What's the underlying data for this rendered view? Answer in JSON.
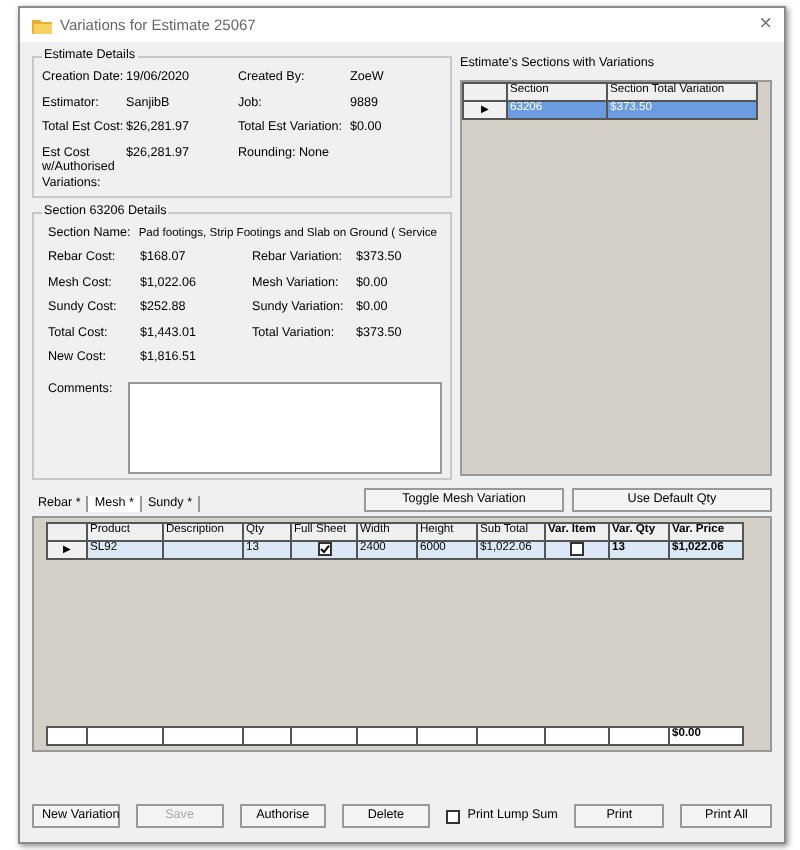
{
  "window": {
    "title": "Variations for Estimate 25067",
    "close": "×"
  },
  "estimate_details": {
    "title": "Estimate Details",
    "rows": [
      {
        "cells": [
          {
            "label": "Creation Date:",
            "value": "19/06/2020"
          },
          {
            "label": "Created By:",
            "value": "ZoeW"
          }
        ]
      },
      {
        "cells": [
          {
            "label": "Estimator:",
            "value": "SanjibB"
          },
          {
            "label": "Job:",
            "value": "9889"
          }
        ]
      },
      {
        "cells": [
          {
            "label": "Total Est Cost:",
            "value": "$26,281.97"
          },
          {
            "label": "Total Est Variation:",
            "value": "$0.00"
          }
        ]
      },
      {
        "cells": [
          {
            "label": "Est Cost w/Authorised Variations:",
            "value": "$26,281.97"
          },
          {
            "label": "Rounding: None"
          }
        ]
      }
    ]
  },
  "section_details": {
    "title": "Section 63206 Details",
    "name_label": "Section Name:",
    "name_value": "Pad footings, Strip Footings and Slab on Ground ( Service",
    "rows": [
      {
        "cells": [
          {
            "label": "Rebar Cost:",
            "value": "$168.07"
          },
          {
            "label": "Rebar Variation:",
            "value": "$373.50"
          }
        ]
      },
      {
        "cells": [
          {
            "label": "Mesh Cost:",
            "value": "$1,022.06"
          },
          {
            "label": "Mesh Variation:",
            "value": "$0.00"
          }
        ]
      },
      {
        "cells": [
          {
            "label": "Sundy Cost:",
            "value": "$252.88"
          },
          {
            "label": "Sundy Variation:",
            "value": "$0.00"
          }
        ]
      },
      {
        "cells": [
          {
            "label": "Total Cost:",
            "value": "$1,443.01"
          },
          {
            "label": "Total Variation:",
            "value": "$373.50"
          }
        ]
      },
      {
        "cells": [
          {
            "label": "New Cost:",
            "value": "$1,816.51"
          }
        ]
      }
    ],
    "comments_label": "Comments:"
  },
  "sections_grid": {
    "title": "Estimate's Sections with Variations",
    "columns": [
      "Section",
      "Section Total Variation"
    ],
    "rows": [
      {
        "marker": "▶",
        "cells": [
          "63206",
          "$373.50"
        ],
        "selected": true
      }
    ]
  },
  "tabs": [
    {
      "label": "Rebar *",
      "selected": false
    },
    {
      "label": "Mesh *",
      "selected": true
    },
    {
      "label": "Sundy *",
      "selected": false
    }
  ],
  "toolbar_buttons": [
    "Toggle Mesh Variation",
    "Use Default Qty"
  ],
  "products_grid": {
    "columns": [
      {
        "label": "Product",
        "bold": false
      },
      {
        "label": "Description",
        "bold": false
      },
      {
        "label": "Qty",
        "bold": false
      },
      {
        "label": "Full Sheet",
        "bold": false
      },
      {
        "label": "Width",
        "bold": false
      },
      {
        "label": "Height",
        "bold": false
      },
      {
        "label": "Sub Total",
        "bold": false
      },
      {
        "label": "Var. Item",
        "bold": true
      },
      {
        "label": "Var. Qty",
        "bold": true
      },
      {
        "label": "Var. Price",
        "bold": true
      }
    ],
    "rows": [
      {
        "marker": "▶",
        "selected": true,
        "cells": [
          {
            "kind": "text",
            "text": "SL92"
          },
          {
            "kind": "empty"
          },
          {
            "kind": "text",
            "text": "13"
          },
          {
            "kind": "check",
            "checked": true
          },
          {
            "kind": "text",
            "text": "2400"
          },
          {
            "kind": "text",
            "text": "6000"
          },
          {
            "kind": "text",
            "text": "$1,022.06"
          },
          {
            "kind": "check",
            "checked": false
          },
          {
            "kind": "text",
            "text": "13"
          },
          {
            "kind": "text",
            "text": "$1,022.06"
          }
        ]
      }
    ],
    "var_price_total": "$0.00"
  },
  "buttons": [
    {
      "label": "New Variation",
      "disabled": false
    },
    {
      "label": "Save",
      "disabled": true
    },
    {
      "label": "Authorise",
      "disabled": false
    },
    {
      "label": "Delete",
      "disabled": false
    }
  ],
  "print_lump_sum": {
    "label": "Print Lump Sum",
    "checked": false
  },
  "print_buttons": [
    "Print",
    "Print All"
  ]
}
